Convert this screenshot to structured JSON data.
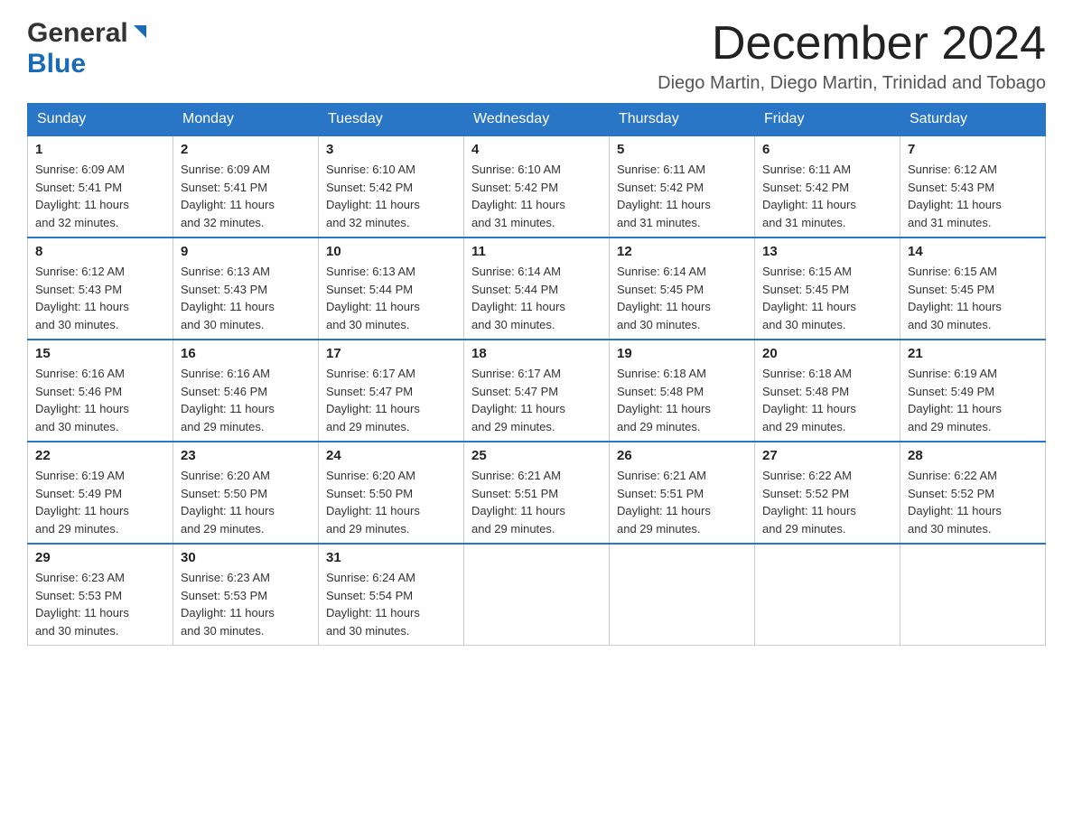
{
  "header": {
    "logo_general": "General",
    "logo_blue": "Blue",
    "month_year": "December 2024",
    "location": "Diego Martin, Diego Martin, Trinidad and Tobago"
  },
  "days_of_week": [
    "Sunday",
    "Monday",
    "Tuesday",
    "Wednesday",
    "Thursday",
    "Friday",
    "Saturday"
  ],
  "weeks": [
    [
      {
        "day": "1",
        "sunrise": "6:09 AM",
        "sunset": "5:41 PM",
        "daylight": "11 hours and 32 minutes."
      },
      {
        "day": "2",
        "sunrise": "6:09 AM",
        "sunset": "5:41 PM",
        "daylight": "11 hours and 32 minutes."
      },
      {
        "day": "3",
        "sunrise": "6:10 AM",
        "sunset": "5:42 PM",
        "daylight": "11 hours and 32 minutes."
      },
      {
        "day": "4",
        "sunrise": "6:10 AM",
        "sunset": "5:42 PM",
        "daylight": "11 hours and 31 minutes."
      },
      {
        "day": "5",
        "sunrise": "6:11 AM",
        "sunset": "5:42 PM",
        "daylight": "11 hours and 31 minutes."
      },
      {
        "day": "6",
        "sunrise": "6:11 AM",
        "sunset": "5:42 PM",
        "daylight": "11 hours and 31 minutes."
      },
      {
        "day": "7",
        "sunrise": "6:12 AM",
        "sunset": "5:43 PM",
        "daylight": "11 hours and 31 minutes."
      }
    ],
    [
      {
        "day": "8",
        "sunrise": "6:12 AM",
        "sunset": "5:43 PM",
        "daylight": "11 hours and 30 minutes."
      },
      {
        "day": "9",
        "sunrise": "6:13 AM",
        "sunset": "5:43 PM",
        "daylight": "11 hours and 30 minutes."
      },
      {
        "day": "10",
        "sunrise": "6:13 AM",
        "sunset": "5:44 PM",
        "daylight": "11 hours and 30 minutes."
      },
      {
        "day": "11",
        "sunrise": "6:14 AM",
        "sunset": "5:44 PM",
        "daylight": "11 hours and 30 minutes."
      },
      {
        "day": "12",
        "sunrise": "6:14 AM",
        "sunset": "5:45 PM",
        "daylight": "11 hours and 30 minutes."
      },
      {
        "day": "13",
        "sunrise": "6:15 AM",
        "sunset": "5:45 PM",
        "daylight": "11 hours and 30 minutes."
      },
      {
        "day": "14",
        "sunrise": "6:15 AM",
        "sunset": "5:45 PM",
        "daylight": "11 hours and 30 minutes."
      }
    ],
    [
      {
        "day": "15",
        "sunrise": "6:16 AM",
        "sunset": "5:46 PM",
        "daylight": "11 hours and 30 minutes."
      },
      {
        "day": "16",
        "sunrise": "6:16 AM",
        "sunset": "5:46 PM",
        "daylight": "11 hours and 29 minutes."
      },
      {
        "day": "17",
        "sunrise": "6:17 AM",
        "sunset": "5:47 PM",
        "daylight": "11 hours and 29 minutes."
      },
      {
        "day": "18",
        "sunrise": "6:17 AM",
        "sunset": "5:47 PM",
        "daylight": "11 hours and 29 minutes."
      },
      {
        "day": "19",
        "sunrise": "6:18 AM",
        "sunset": "5:48 PM",
        "daylight": "11 hours and 29 minutes."
      },
      {
        "day": "20",
        "sunrise": "6:18 AM",
        "sunset": "5:48 PM",
        "daylight": "11 hours and 29 minutes."
      },
      {
        "day": "21",
        "sunrise": "6:19 AM",
        "sunset": "5:49 PM",
        "daylight": "11 hours and 29 minutes."
      }
    ],
    [
      {
        "day": "22",
        "sunrise": "6:19 AM",
        "sunset": "5:49 PM",
        "daylight": "11 hours and 29 minutes."
      },
      {
        "day": "23",
        "sunrise": "6:20 AM",
        "sunset": "5:50 PM",
        "daylight": "11 hours and 29 minutes."
      },
      {
        "day": "24",
        "sunrise": "6:20 AM",
        "sunset": "5:50 PM",
        "daylight": "11 hours and 29 minutes."
      },
      {
        "day": "25",
        "sunrise": "6:21 AM",
        "sunset": "5:51 PM",
        "daylight": "11 hours and 29 minutes."
      },
      {
        "day": "26",
        "sunrise": "6:21 AM",
        "sunset": "5:51 PM",
        "daylight": "11 hours and 29 minutes."
      },
      {
        "day": "27",
        "sunrise": "6:22 AM",
        "sunset": "5:52 PM",
        "daylight": "11 hours and 29 minutes."
      },
      {
        "day": "28",
        "sunrise": "6:22 AM",
        "sunset": "5:52 PM",
        "daylight": "11 hours and 30 minutes."
      }
    ],
    [
      {
        "day": "29",
        "sunrise": "6:23 AM",
        "sunset": "5:53 PM",
        "daylight": "11 hours and 30 minutes."
      },
      {
        "day": "30",
        "sunrise": "6:23 AM",
        "sunset": "5:53 PM",
        "daylight": "11 hours and 30 minutes."
      },
      {
        "day": "31",
        "sunrise": "6:24 AM",
        "sunset": "5:54 PM",
        "daylight": "11 hours and 30 minutes."
      },
      null,
      null,
      null,
      null
    ]
  ],
  "labels": {
    "sunrise": "Sunrise:",
    "sunset": "Sunset:",
    "daylight": "Daylight:"
  }
}
